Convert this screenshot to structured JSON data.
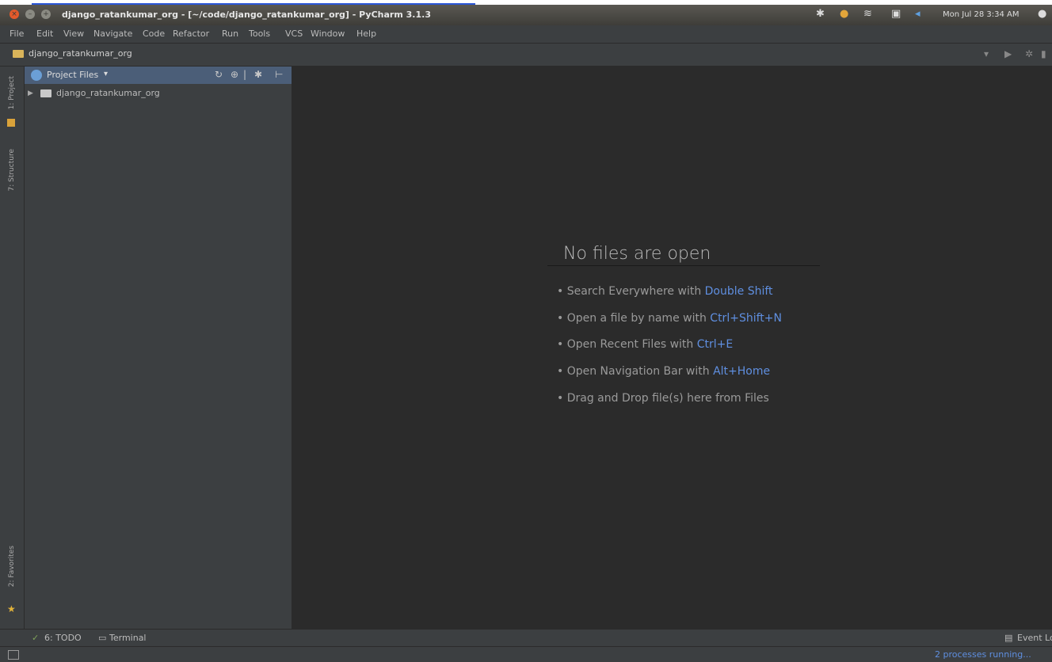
{
  "os": {
    "window_title": "django_ratankumar_org - [~/code/django_ratankumar_org] - PyCharm 3.1.3",
    "clock": "Mon Jul 28 3:34 AM"
  },
  "menu": [
    "File",
    "Edit",
    "View",
    "Navigate",
    "Code",
    "Refactor",
    "Run",
    "Tools",
    "VCS",
    "Window",
    "Help"
  ],
  "breadcrumb": {
    "label": "django_ratankumar_org"
  },
  "left_stripe": {
    "project_label": "1: Project",
    "structure_label": "7: Structure",
    "favorites_label": "2: Favorites"
  },
  "project_panel": {
    "title": "Project Files",
    "tree": [
      {
        "label": "django_ratankumar_org"
      }
    ]
  },
  "editor": {
    "empty_title": "No files are open",
    "hints": [
      {
        "text": "Search Everywhere with ",
        "shortcut": "Double Shift"
      },
      {
        "text": "Open a file by name with ",
        "shortcut": "Ctrl+Shift+N"
      },
      {
        "text": "Open Recent Files with ",
        "shortcut": "Ctrl+E"
      },
      {
        "text": "Open Navigation Bar with ",
        "shortcut": "Alt+Home"
      },
      {
        "text": "Drag and Drop file(s) here from Files",
        "shortcut": ""
      }
    ]
  },
  "tool_windows": {
    "todo": "6: TODO",
    "terminal": "Terminal",
    "event_log": "Event Log"
  },
  "status": {
    "background_tasks": "2 processes running..."
  },
  "colors": {
    "editor_bg": "#2b2b2b",
    "panel_bg": "#3c3f41",
    "link": "#5f8fe0",
    "selection": "#4b5e78"
  }
}
